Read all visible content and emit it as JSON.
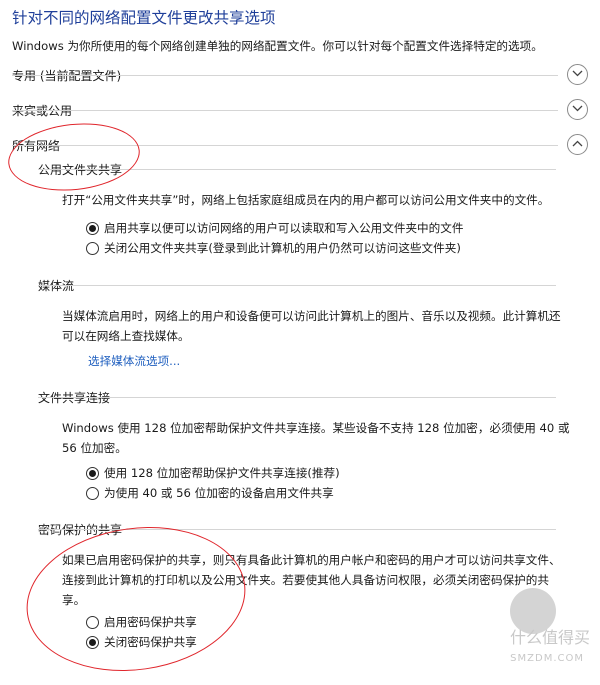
{
  "header": {
    "title": "针对不同的网络配置文件更改共享选项",
    "description": "Windows 为你所使用的每个网络创建单独的网络配置文件。你可以针对每个配置文件选择特定的选项。"
  },
  "sections": {
    "private": {
      "label": "专用 (当前配置文件)",
      "expanded": false
    },
    "guest": {
      "label": "来宾或公用",
      "expanded": false
    },
    "all": {
      "label": "所有网络",
      "expanded": true
    }
  },
  "public_folder": {
    "heading": "公用文件夹共享",
    "text": "打开“公用文件夹共享”时，网络上包括家庭组成员在内的用户都可以访问公用文件夹中的文件。",
    "options": [
      {
        "label": "启用共享以便可以访问网络的用户可以读取和写入公用文件夹中的文件",
        "selected": true
      },
      {
        "label": "关闭公用文件夹共享(登录到此计算机的用户仍然可以访问这些文件夹)",
        "selected": false
      }
    ]
  },
  "media": {
    "heading": "媒体流",
    "text_line1": "当媒体流启用时，网络上的用户和设备便可以访问此计算机上的图片、音乐以及视频。此计算机还",
    "text_line2": "可以在网络上查找媒体。",
    "link": "选择媒体流选项..."
  },
  "file_sharing": {
    "heading": "文件共享连接",
    "text_line1": "Windows 使用 128 位加密帮助保护文件共享连接。某些设备不支持 128 位加密，必须使用 40 或",
    "text_line2": "56 位加密。",
    "options": [
      {
        "label": "使用 128 位加密帮助保护文件共享连接(推荐)",
        "selected": true
      },
      {
        "label": "为使用 40 或 56 位加密的设备启用文件共享",
        "selected": false
      }
    ]
  },
  "password": {
    "heading": "密码保护的共享",
    "text_line1": "如果已启用密码保护的共享，则只有具备此计算机的用户帐户和密码的用户才可以访问共享文件、",
    "text_line2": "连接到此计算机的打印机以及公用文件夹。若要使其他人具备访问权限，必须关闭密码保护的共",
    "text_line3": "享。",
    "options": [
      {
        "label": "启用密码保护共享",
        "selected": false
      },
      {
        "label": "关闭密码保护共享",
        "selected": true
      }
    ]
  },
  "watermark": {
    "text": "什么值得买",
    "url": "SMZDM.COM"
  },
  "colors": {
    "title": "#1f3f9a",
    "link": "#1f5fbf",
    "annotation": "#e0262c"
  }
}
